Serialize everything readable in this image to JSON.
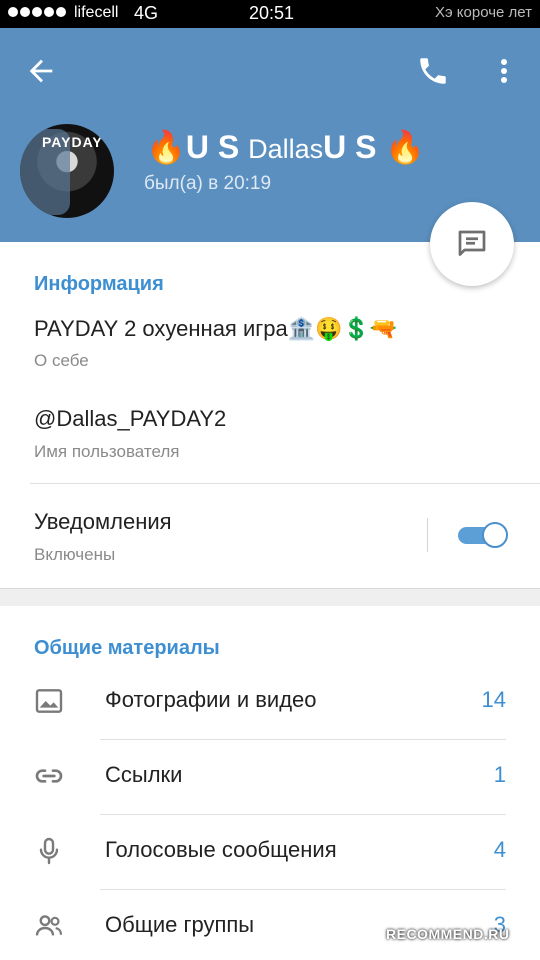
{
  "status_bar": {
    "carrier": "lifecell",
    "network": "4G",
    "time": "20:51",
    "right_text": "Хэ короче лет"
  },
  "header": {
    "name_prefix": "🔥U S ",
    "name_main": "Dallas",
    "name_suffix": "U S 🔥",
    "last_seen": "был(а) в 20:19",
    "avatar_text": "PAYDAY",
    "accent_color": "#5b8fbf"
  },
  "info": {
    "section_title": "Информация",
    "bio": "PAYDAY 2 охуенная игра🏦🤑💲🔫",
    "bio_label": "О себе",
    "username": "@Dallas_PAYDAY2",
    "username_label": "Имя пользователя",
    "notifications_title": "Уведомления",
    "notifications_status": "Включены",
    "notifications_on": true
  },
  "shared": {
    "section_title": "Общие материалы",
    "items": [
      {
        "icon": "image-icon",
        "label": "Фотографии и видео",
        "count": "14"
      },
      {
        "icon": "link-icon",
        "label": "Ссылки",
        "count": "1"
      },
      {
        "icon": "microphone-icon",
        "label": "Голосовые сообщения",
        "count": "4"
      },
      {
        "icon": "group-icon",
        "label": "Общие группы",
        "count": "3"
      }
    ]
  },
  "watermark": "RECOMMEND.RU"
}
